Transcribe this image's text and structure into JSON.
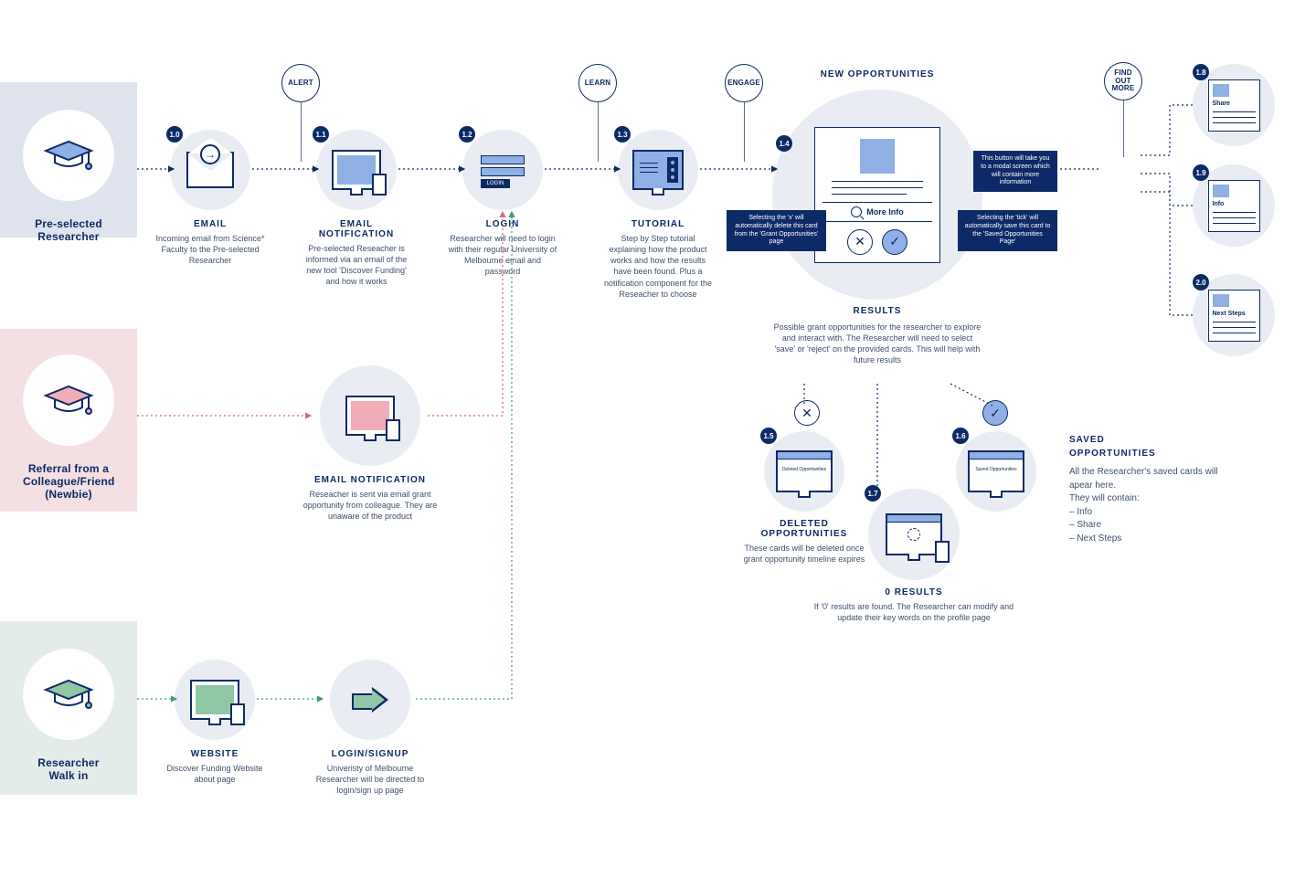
{
  "personas": {
    "preselected": "Pre-selected\nResearcher",
    "referral": "Referral from a\nColleague/Friend\n(Newbie)",
    "walkin": "Researcher\nWalk in"
  },
  "tags": {
    "alert": "ALERT",
    "learn": "LEARN",
    "engage": "ENGAGE",
    "findout": "FIND\nOUT\nMORE"
  },
  "steps": {
    "email": {
      "n": "1.0",
      "title": "EMAIL",
      "desc": "Incoming email from Science* Faculty to the Pre-selected Researcher"
    },
    "notif": {
      "n": "1.1",
      "title": "EMAIL NOTIFICATION",
      "desc": "Pre-selected Reseacher is informed via an email of the new tool 'Discover Funding' and how it works"
    },
    "login": {
      "n": "1.2",
      "title": "LOGIN",
      "desc": "Researcher will need to login with their regular University of Melbourne email and password",
      "btn": "LOGIN"
    },
    "tutorial": {
      "n": "1.3",
      "title": "TUTORIAL",
      "desc": "Step by Step tutorial explaining how the product works and how the results have been found. Plus a notification component for the Reseacher to choose"
    },
    "notif2": {
      "title": "EMAIL NOTIFICATION",
      "desc": "Reseacher is sent via email grant opportunity from colleague. They are unaware of the product"
    },
    "website": {
      "title": "WEBSITE",
      "desc": "Discover Funding Website about page"
    },
    "loginsignup": {
      "title": "LOGIN/SIGNUP",
      "desc": "Univeristy of Melbourne Researcher will be directed to login/sign up page"
    }
  },
  "results": {
    "n": "1.4",
    "bigTitle": "NEW OPPORTUNITIES",
    "more": "More Info",
    "title": "RESULTS",
    "desc": "Possible grant opportunities for the researcher to explore and interact with. The Researcher will need to select 'save' or 'reject' on the provided cards. This will help with future results",
    "noteX": "Selecting the 'x' will automatically delete this card from the 'Grant Opportunities' page",
    "noteTick": "Selecting the 'tick' will automatically save this card to the 'Saved Opportunities Page'",
    "noteMore": "This button will take you to a modal screen which will contain more information"
  },
  "subs": {
    "deleted": {
      "n": "1.5",
      "title": "DELETED\nOPPORTUNITIES",
      "desc": "These cards will be deleted once grant opportunity timeline expires",
      "mini": "Deleted Opportunities"
    },
    "zero": {
      "n": "1.7",
      "title": "0 RESULTS",
      "desc": "If '0' results are found. The Researcher can modify and update their key words on the profile page"
    },
    "saved": {
      "n": "1.6",
      "title": "SAVED\nOPPORTUNITIES",
      "desc": "All the Researcher's saved cards will apear here.\nThey will contain:\n– Info\n– Share\n– Next Steps",
      "mini": "Saved Opportunities"
    }
  },
  "sheets": {
    "share": {
      "n": "1.8",
      "label": "Share"
    },
    "info": {
      "n": "1.9",
      "label": "Info"
    },
    "next": {
      "n": "2.0",
      "label": "Next Steps"
    }
  }
}
